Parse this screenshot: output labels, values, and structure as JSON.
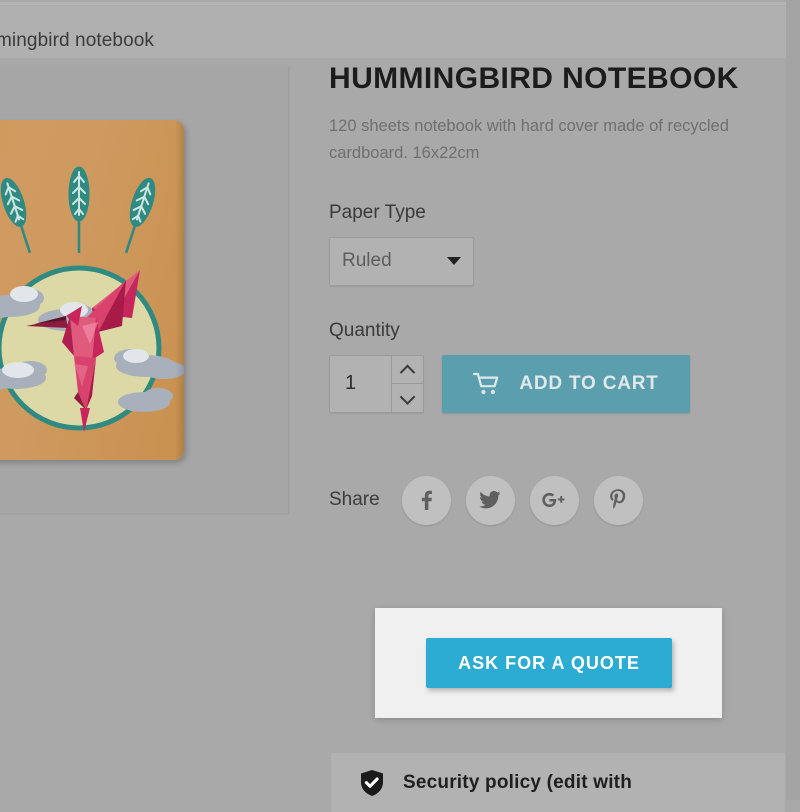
{
  "breadcrumb": {
    "text": "mingbird notebook",
    "note_truncated": true
  },
  "product": {
    "title": "HUMMINGBIRD NOTEBOOK",
    "description": "120 sheets notebook with hard cover made of recycled cardboard. 16x22cm",
    "image_alt": "Kraft cardboard notebook cover with origami hummingbird and feathers"
  },
  "paper_type": {
    "label": "Paper Type",
    "selected": "Ruled",
    "options": [
      "Ruled"
    ],
    "caret_icon": "chevron-down-icon"
  },
  "quantity": {
    "label": "Quantity",
    "value": "1",
    "increase_icon": "chevron-up-icon",
    "decrease_icon": "chevron-down-icon"
  },
  "add_to_cart": {
    "label": "ADD TO CART",
    "icon": "shopping-cart-icon",
    "color": "#5b9fae"
  },
  "share": {
    "label": "Share",
    "networks": [
      {
        "name": "facebook",
        "icon": "facebook-icon",
        "glyph": "f"
      },
      {
        "name": "twitter",
        "icon": "twitter-icon",
        "glyph": "bird"
      },
      {
        "name": "google-plus",
        "icon": "google-plus-icon",
        "glyph": "G+"
      },
      {
        "name": "pinterest",
        "icon": "pinterest-icon",
        "glyph": "P"
      }
    ]
  },
  "quote": {
    "label": "ASK FOR A QUOTE",
    "color": "#2cacd2",
    "panel_color": "#f0f0f0",
    "highlighted": true
  },
  "security": {
    "text": "Security policy (edit with",
    "icon": "shield-check-icon"
  },
  "colors": {
    "page_background": "#a9a9a9",
    "breadcrumb_background": "#b0b0b0",
    "image_panel_background": "#a6a6a6",
    "notebook_cover": "#cf9a60",
    "accent_teal": "#2cacd2",
    "cart_teal": "#5b9fae",
    "bird_crimson": "#c8255c",
    "feather_teal": "#2f8a82",
    "circle_cream": "#ddd9a6",
    "cloud_gray": "#a8b0bc"
  }
}
